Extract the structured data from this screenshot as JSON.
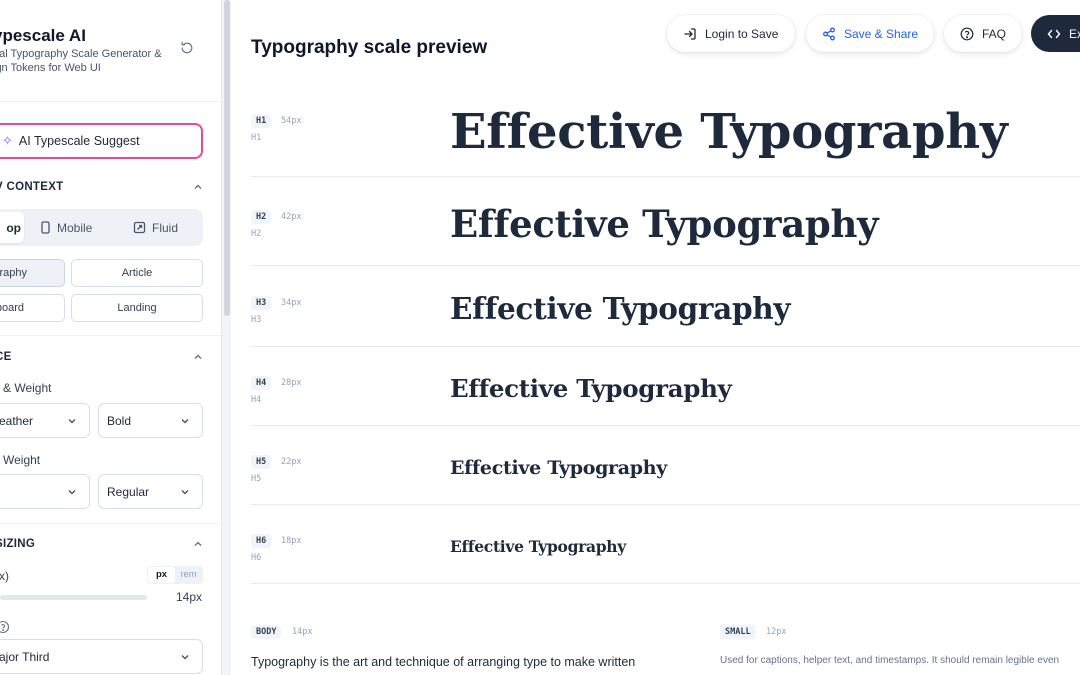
{
  "app": {
    "title": "ypescale AI",
    "subtitle_line1": "ual Typography Scale Generator &",
    "subtitle_line2": "ign Tokens for Web UI"
  },
  "sidebar": {
    "ai_button": "AI Typescale Suggest",
    "preview_context": {
      "heading": "V CONTEXT",
      "devices": [
        "op",
        "Mobile",
        "Fluid"
      ],
      "active_device": "op",
      "presets": [
        "raphy",
        "Article",
        "board",
        "Landing"
      ],
      "active_preset": "raphy"
    },
    "typeface": {
      "heading": "CE",
      "heading_font_label": "& Weight",
      "heading_font_value": "eather",
      "heading_weight_value": "Bold",
      "body_font_label": "Weight",
      "body_font_value": "",
      "body_weight_value": "Regular"
    },
    "sizing": {
      "heading": "SIZING",
      "base_label": "x)",
      "units": [
        "px",
        "rem"
      ],
      "active_unit": "px",
      "base_value": "14px",
      "ratio_value": "ajor Third"
    }
  },
  "toolbar": {
    "login": "Login to Save",
    "save_share": "Save & Share",
    "faq": "FAQ",
    "export": "Ex"
  },
  "main": {
    "title": "Typography scale preview",
    "sample_text": "Effective Typography",
    "scale": [
      {
        "tag": "H1",
        "size": "54px",
        "sub": "H1"
      },
      {
        "tag": "H2",
        "size": "42px",
        "sub": "H2"
      },
      {
        "tag": "H3",
        "size": "34px",
        "sub": "H3"
      },
      {
        "tag": "H4",
        "size": "28px",
        "sub": "H4"
      },
      {
        "tag": "H5",
        "size": "22px",
        "sub": "H5"
      },
      {
        "tag": "H6",
        "size": "18px",
        "sub": "H6"
      }
    ],
    "body": {
      "tag": "BODY",
      "size": "14px",
      "text": "Typography is the art and technique of arranging type to make written"
    },
    "small": {
      "tag": "SMALL",
      "size": "12px",
      "text": "Used for captions, helper text, and timestamps. It should remain legible even"
    }
  },
  "colors": {
    "accent": "#2563eb",
    "ai_border": "#ec4899",
    "dark_button": "#1e293b"
  }
}
